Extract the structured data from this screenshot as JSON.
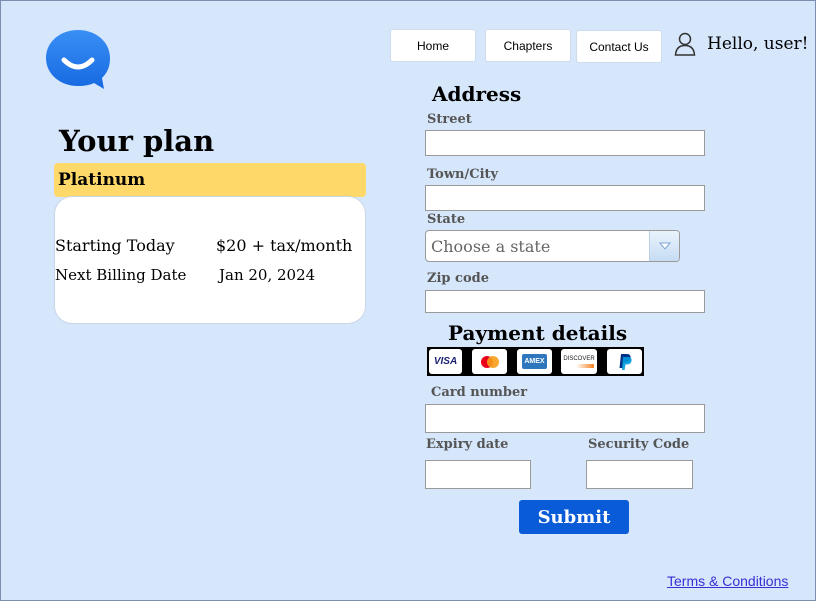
{
  "nav": {
    "home": "Home",
    "chapters": "Chapters",
    "contact": "Contact Us",
    "greeting": "Hello, user!"
  },
  "icons": {
    "logo": "chat-bubble-smile-icon",
    "user": "user-icon",
    "select_arrow": "chevron-down-icon"
  },
  "plan": {
    "title": "Your plan",
    "tier": "Platinum",
    "rows": [
      {
        "label": "Starting Today",
        "value": "$20 + tax/month"
      },
      {
        "label": "Next Billing Date",
        "value": "Jan 20, 2024"
      }
    ]
  },
  "address": {
    "title": "Address",
    "street_label": "Street",
    "town_label": "Town/City",
    "state_label": "State",
    "state_placeholder": "Choose a state",
    "zip_label": "Zip code"
  },
  "payment": {
    "title": "Payment details",
    "cards": [
      "VISA",
      "MasterCard",
      "AMEX",
      "DISCOVER",
      "PayPal"
    ],
    "card_number_label": "Card number",
    "expiry_label": "Expiry date",
    "security_label": "Security Code"
  },
  "submit_label": "Submit",
  "terms_label": "Terms & Conditions",
  "colors": {
    "background": "#d6e6fb",
    "accent": "#0a5bd8",
    "plan_tier": "#fed96a",
    "link": "#3a2fd6"
  }
}
